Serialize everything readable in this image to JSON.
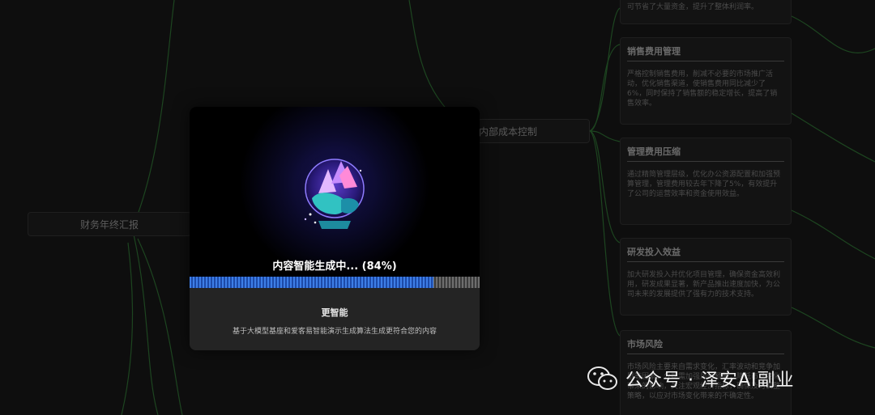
{
  "mindmap": {
    "root_label": "财务年终汇报",
    "branch_label": "内部成本控制",
    "top_card_text": "可节省了大量资金，提升了整体利润率。",
    "cards": [
      {
        "title": "销售费用管理",
        "body": "严格控制销售费用，削减不必要的市场推广活动，优化销售渠道，使销售费用同比减少了6%，同时保持了销售额的稳定增长，提高了销售效率。"
      },
      {
        "title": "管理费用压缩",
        "body": "通过精简管理层级，优化办公资源配置和加强预算管理，管理费用较去年下降了5%，有效提升了公司的运营效率和资金使用效益。"
      },
      {
        "title": "研发投入效益",
        "body": "加大研发投入并优化项目管理，确保资金高效利用，研发成果显著，新产品推出速度加快，为公司未来的发展提供了强有力的技术支持。"
      },
      {
        "title": "市场风险",
        "body": "市场风险主要来自需求变化，汇率波动和竞争加剧等因素，公司需加强风险预警，降低市场变化带来的影响，关注宏观经济指标，确保及时调整策略，以应对市场变化带来的不确定性。"
      }
    ]
  },
  "modal": {
    "status_text": "内容智能生成中... (84%)",
    "progress": 0.84,
    "headline": "更智能",
    "description": "基于大模型基座和爱客易智能演示生成算法生成更符合您的内容"
  },
  "watermark": {
    "text": "公众号 · 泽安AI副业",
    "icon": "wechat-icon"
  },
  "colors": {
    "link_line": "#1f4a22",
    "progress_fill": "#3d7ee6",
    "progress_track": "#5a5a5a"
  }
}
